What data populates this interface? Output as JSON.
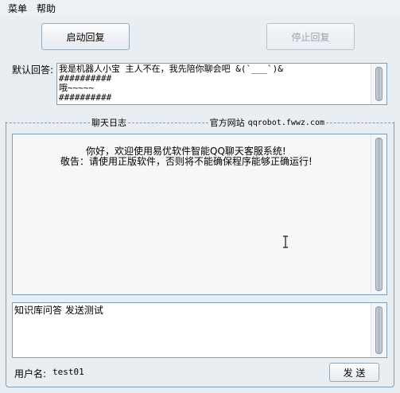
{
  "menu": {
    "items": [
      "菜单",
      "帮助"
    ]
  },
  "buttons": {
    "start": "启动回复",
    "stop": "停止回复",
    "send": "发 送"
  },
  "default_reply": {
    "label": "默认回答:",
    "lines": [
      "我是机器人小宝 主人不在，我先陪你聊会吧 &(`___`)&",
      "##########",
      "哦~~~~~",
      "##########"
    ]
  },
  "group": {
    "chat_log_title": "聊天日志",
    "site_title": "官方网站",
    "site_url": "qqrobot.fwwz.com"
  },
  "chat_log": {
    "lines": [
      "你好，欢迎使用易优软件智能QQ聊天客服系统!",
      "敬告：请使用正版软件，否则将不能确保程序能够正确运行!"
    ]
  },
  "input": {
    "value": "知识库问答 发送测试"
  },
  "user": {
    "label": "用户名:",
    "name": "test01"
  }
}
